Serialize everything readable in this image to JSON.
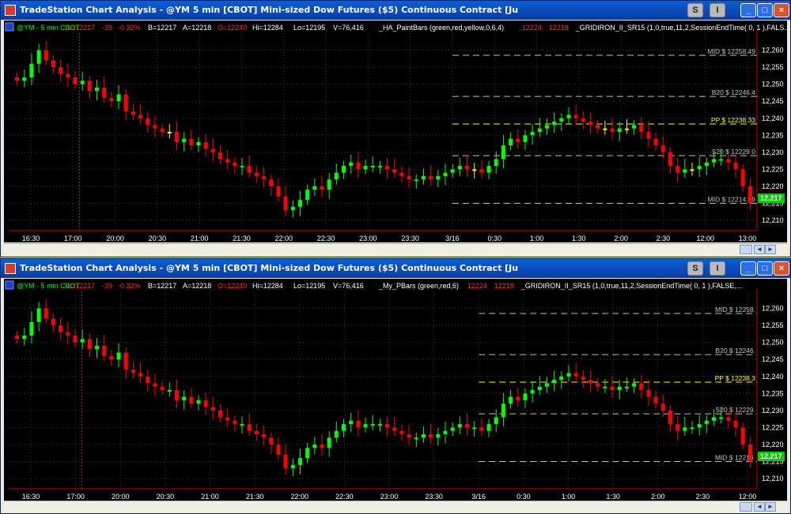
{
  "windows": [
    {
      "title": "TradeStation Chart Analysis - @YM  5 min  [CBOT] Mini-sized Dow Futures ($5) Continuous Contract [Ju",
      "status": {
        "symbol": "@YM - 5 min  CBOT",
        "last": "L=12217",
        "change": "-39",
        "pct": "-0.32%",
        "bid": "B=12217",
        "ask": "A=12218",
        "open": "O=12240",
        "high": "Hi=12284",
        "low": "Lo=12195",
        "volume": "V=76,416",
        "study1": "_HA_PaintBars (green,red,yellow,0,6,4)",
        "bidask_a": "12224",
        "bidask_b": "12218",
        "study2": "_GRIDIRON_II_SR15 (1,0,true,11,2,SessionEndTime( 0, 1 ),FALS..."
      },
      "levels": [
        {
          "label": "MID $ 12258.49",
          "value": 12258.49,
          "color": "#c0c0c0"
        },
        {
          "label": "B20 $ 12246.4",
          "value": 12246.4,
          "color": "#c0c0c0"
        },
        {
          "label": "PP $ 12238.33",
          "value": 12238.33,
          "color": "#ffff00"
        },
        {
          "label": "S20 $ 12229.0",
          "value": 12229.0,
          "color": "#c0c0c0"
        },
        {
          "label": "MID $ 12214.99",
          "value": 12214.99,
          "color": "#c0c0c0"
        }
      ],
      "last_price_tag": "12,217",
      "time_labels": [
        "16:30",
        "17:00",
        "20:00",
        "20:30",
        "21:00",
        "21:30",
        "22:00",
        "22:30",
        "23:00",
        "23:30",
        "3/16",
        "0:30",
        "1:00",
        "1:30",
        "2:00",
        "2:30",
        "12:00",
        "13:00"
      ],
      "price_labels": [
        "12,260",
        "12,255",
        "12,250",
        "12,245",
        "12,240",
        "12,235",
        "12,230",
        "12,225",
        "12,220",
        "12,215",
        "12,210"
      ]
    },
    {
      "title": "TradeStation Chart Analysis - @YM  5 min  [CBOT] Mini-sized Dow Futures ($5) Continuous Contract [Ju",
      "status": {
        "symbol": "@YM - 5 min  CBOT",
        "last": "L=12217",
        "change": "-39",
        "pct": "-0.32%",
        "bid": "B=12217",
        "ask": "A=12218",
        "open": "O=12240",
        "high": "Hi=12284",
        "low": "Lo=12195",
        "volume": "V=76,416",
        "study1": "_My_PBars (green,red,6)",
        "bidask_a": "12224",
        "bidask_b": "12218",
        "study2": "_GRIDIRON_II_SR15 (1,0,true,11,2,SessionEndTime( 0, 1 ),FALSE,..."
      },
      "levels": [
        {
          "label": "MID $ 12258.",
          "value": 12258.49,
          "color": "#c0c0c0"
        },
        {
          "label": "B20 $ 12246.",
          "value": 12246.4,
          "color": "#c0c0c0"
        },
        {
          "label": "PP $ 12238.3",
          "value": 12238.33,
          "color": "#ffff00"
        },
        {
          "label": "S20 $ 12229.",
          "value": 12229.0,
          "color": "#c0c0c0"
        },
        {
          "label": "MID $ 12214.",
          "value": 12214.99,
          "color": "#c0c0c0"
        }
      ],
      "last_price_tag": "12,217",
      "time_labels": [
        "16:30",
        "17:00",
        "20:00",
        "20:30",
        "21:00",
        "21:30",
        "22:00",
        "22:30",
        "23:00",
        "23:30",
        "3/16",
        "0:30",
        "1:00",
        "1:30",
        "2:00",
        "2:30",
        "12:00"
      ],
      "price_labels": [
        "12,260",
        "12,255",
        "12,250",
        "12,245",
        "12,240",
        "12,235",
        "12,230",
        "12,225",
        "12,220",
        "12,215",
        "12,210"
      ]
    }
  ],
  "buttons": {
    "s": "S",
    "i": "I",
    "min": "_",
    "max": "□",
    "close": "×"
  },
  "colors": {
    "up": "#00ff00",
    "down": "#ff0000",
    "neutral": "#ffff00",
    "grid": "#3a3a3a",
    "axis": "#c00000",
    "label": "#ffffff",
    "accent": "#0a5fd8"
  },
  "chart_data": [
    {
      "type": "candlestick",
      "title": "@YM - 5 min  CBOT",
      "ylim": [
        12207,
        12265
      ],
      "series_close": [
        12251,
        12252,
        12256,
        12260,
        12257,
        12255,
        12253,
        12252,
        12250,
        12251,
        12248,
        12249,
        12246,
        12245,
        12247,
        12242,
        12241,
        12240,
        12238,
        12237,
        12236,
        12236,
        12233,
        12234,
        12232,
        12233,
        12231,
        12230,
        12228,
        12227,
        12226,
        12226,
        12224,
        12223,
        12222,
        12220,
        12217,
        12213,
        12214,
        12216,
        12219,
        12220,
        12219,
        12222,
        12224,
        12226,
        12227,
        12225,
        12226,
        12226,
        12226,
        12225,
        12224,
        12223,
        12222,
        12222,
        12223,
        12222,
        12223,
        12224,
        12225,
        12226,
        12225,
        12225,
        12224,
        12226,
        12228,
        12232,
        12234,
        12233,
        12235,
        12236,
        12237,
        12238,
        12239,
        12240,
        12241,
        12240,
        12239,
        12238,
        12237,
        12237,
        12236,
        12237,
        12237,
        12238,
        12236,
        12234,
        12232,
        12230,
        12226,
        12224,
        12225,
        12225,
        12226,
        12227,
        12228,
        12228,
        12227,
        12225,
        12220,
        12215
      ],
      "trading_session_start_label": "3/16"
    }
  ]
}
